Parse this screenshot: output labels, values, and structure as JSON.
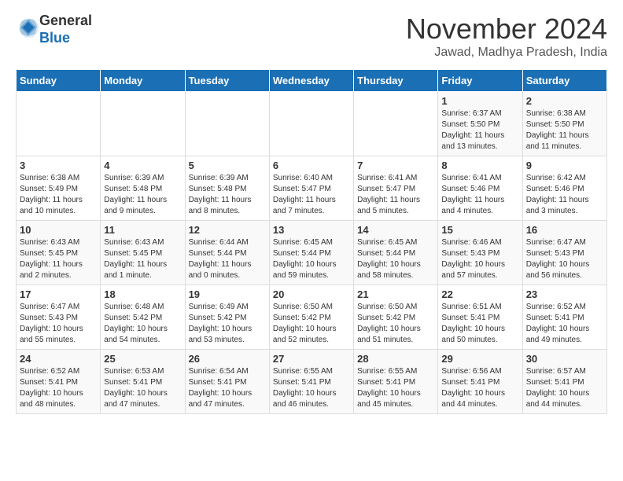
{
  "logo": {
    "general": "General",
    "blue": "Blue"
  },
  "header": {
    "month": "November 2024",
    "location": "Jawad, Madhya Pradesh, India"
  },
  "days_of_week": [
    "Sunday",
    "Monday",
    "Tuesday",
    "Wednesday",
    "Thursday",
    "Friday",
    "Saturday"
  ],
  "weeks": [
    [
      {
        "day": "",
        "info": ""
      },
      {
        "day": "",
        "info": ""
      },
      {
        "day": "",
        "info": ""
      },
      {
        "day": "",
        "info": ""
      },
      {
        "day": "",
        "info": ""
      },
      {
        "day": "1",
        "info": "Sunrise: 6:37 AM\nSunset: 5:50 PM\nDaylight: 11 hours and 13 minutes."
      },
      {
        "day": "2",
        "info": "Sunrise: 6:38 AM\nSunset: 5:50 PM\nDaylight: 11 hours and 11 minutes."
      }
    ],
    [
      {
        "day": "3",
        "info": "Sunrise: 6:38 AM\nSunset: 5:49 PM\nDaylight: 11 hours and 10 minutes."
      },
      {
        "day": "4",
        "info": "Sunrise: 6:39 AM\nSunset: 5:48 PM\nDaylight: 11 hours and 9 minutes."
      },
      {
        "day": "5",
        "info": "Sunrise: 6:39 AM\nSunset: 5:48 PM\nDaylight: 11 hours and 8 minutes."
      },
      {
        "day": "6",
        "info": "Sunrise: 6:40 AM\nSunset: 5:47 PM\nDaylight: 11 hours and 7 minutes."
      },
      {
        "day": "7",
        "info": "Sunrise: 6:41 AM\nSunset: 5:47 PM\nDaylight: 11 hours and 5 minutes."
      },
      {
        "day": "8",
        "info": "Sunrise: 6:41 AM\nSunset: 5:46 PM\nDaylight: 11 hours and 4 minutes."
      },
      {
        "day": "9",
        "info": "Sunrise: 6:42 AM\nSunset: 5:46 PM\nDaylight: 11 hours and 3 minutes."
      }
    ],
    [
      {
        "day": "10",
        "info": "Sunrise: 6:43 AM\nSunset: 5:45 PM\nDaylight: 11 hours and 2 minutes."
      },
      {
        "day": "11",
        "info": "Sunrise: 6:43 AM\nSunset: 5:45 PM\nDaylight: 11 hours and 1 minute."
      },
      {
        "day": "12",
        "info": "Sunrise: 6:44 AM\nSunset: 5:44 PM\nDaylight: 11 hours and 0 minutes."
      },
      {
        "day": "13",
        "info": "Sunrise: 6:45 AM\nSunset: 5:44 PM\nDaylight: 10 hours and 59 minutes."
      },
      {
        "day": "14",
        "info": "Sunrise: 6:45 AM\nSunset: 5:44 PM\nDaylight: 10 hours and 58 minutes."
      },
      {
        "day": "15",
        "info": "Sunrise: 6:46 AM\nSunset: 5:43 PM\nDaylight: 10 hours and 57 minutes."
      },
      {
        "day": "16",
        "info": "Sunrise: 6:47 AM\nSunset: 5:43 PM\nDaylight: 10 hours and 56 minutes."
      }
    ],
    [
      {
        "day": "17",
        "info": "Sunrise: 6:47 AM\nSunset: 5:43 PM\nDaylight: 10 hours and 55 minutes."
      },
      {
        "day": "18",
        "info": "Sunrise: 6:48 AM\nSunset: 5:42 PM\nDaylight: 10 hours and 54 minutes."
      },
      {
        "day": "19",
        "info": "Sunrise: 6:49 AM\nSunset: 5:42 PM\nDaylight: 10 hours and 53 minutes."
      },
      {
        "day": "20",
        "info": "Sunrise: 6:50 AM\nSunset: 5:42 PM\nDaylight: 10 hours and 52 minutes."
      },
      {
        "day": "21",
        "info": "Sunrise: 6:50 AM\nSunset: 5:42 PM\nDaylight: 10 hours and 51 minutes."
      },
      {
        "day": "22",
        "info": "Sunrise: 6:51 AM\nSunset: 5:41 PM\nDaylight: 10 hours and 50 minutes."
      },
      {
        "day": "23",
        "info": "Sunrise: 6:52 AM\nSunset: 5:41 PM\nDaylight: 10 hours and 49 minutes."
      }
    ],
    [
      {
        "day": "24",
        "info": "Sunrise: 6:52 AM\nSunset: 5:41 PM\nDaylight: 10 hours and 48 minutes."
      },
      {
        "day": "25",
        "info": "Sunrise: 6:53 AM\nSunset: 5:41 PM\nDaylight: 10 hours and 47 minutes."
      },
      {
        "day": "26",
        "info": "Sunrise: 6:54 AM\nSunset: 5:41 PM\nDaylight: 10 hours and 47 minutes."
      },
      {
        "day": "27",
        "info": "Sunrise: 6:55 AM\nSunset: 5:41 PM\nDaylight: 10 hours and 46 minutes."
      },
      {
        "day": "28",
        "info": "Sunrise: 6:55 AM\nSunset: 5:41 PM\nDaylight: 10 hours and 45 minutes."
      },
      {
        "day": "29",
        "info": "Sunrise: 6:56 AM\nSunset: 5:41 PM\nDaylight: 10 hours and 44 minutes."
      },
      {
        "day": "30",
        "info": "Sunrise: 6:57 AM\nSunset: 5:41 PM\nDaylight: 10 hours and 44 minutes."
      }
    ]
  ]
}
